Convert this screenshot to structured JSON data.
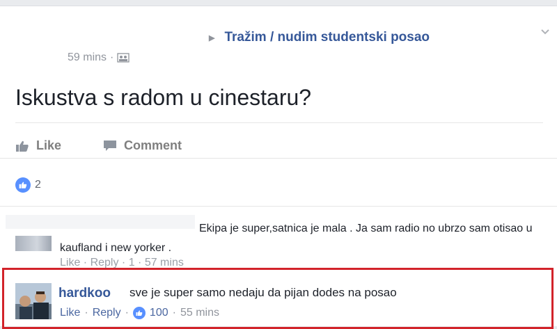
{
  "post": {
    "group_name": "Tražim / nudim studentski posao",
    "time": "59 mins",
    "dot": "·",
    "text": "Iskustva s radom u cinestaru?"
  },
  "actions": {
    "like_label": "Like",
    "comment_label": "Comment"
  },
  "reactions": {
    "count": "2"
  },
  "comments": [
    {
      "text": "Ekipa je super,satnica je mala . Ja sam radio no ubrzo sam otisao u kaufland i new yorker .",
      "actions_partial": "Like · Reply · 1 · 57 mins"
    },
    {
      "author": "hardkoo",
      "text": "sve je super samo nedaju da pijan dodes na posao",
      "like_label": "Like",
      "reply_label": "Reply",
      "sep": "·",
      "like_count": "100",
      "time": "55 mins"
    }
  ],
  "colors": {
    "link": "#365899",
    "accent": "#5890ff",
    "highlight": "#d2232a"
  }
}
